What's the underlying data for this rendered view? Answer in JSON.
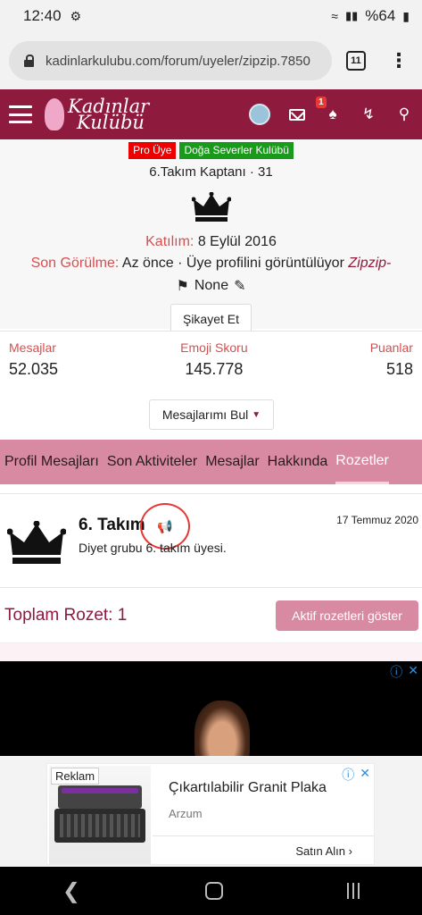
{
  "status_bar": {
    "time": "12:40",
    "battery": "%64"
  },
  "browser": {
    "url": "kadinlarkulubu.com/forum/uyeler/zipzip.7850",
    "tab_count": "11"
  },
  "site": {
    "logo_text_line1": "Kadınlar",
    "logo_text_line2": "Kulübü",
    "notification_badge": "1",
    "brand_color": "#8e1a3d",
    "accent_pink": "#d98aa3"
  },
  "profile": {
    "tags": [
      "Pro Üye",
      "Doğa Severler Kulübü"
    ],
    "subtitle": "6.Takım Kaptanı · 31",
    "joined_label": "Katılım:",
    "joined_value": "8 Eylül 2016",
    "last_seen_label": "Son Görülme:",
    "last_seen_value": "Az önce · Üye profilini görüntülüyor",
    "last_seen_user": "Zipzip-",
    "none_label": "None",
    "report_button": "Şikayet Et"
  },
  "stats": [
    {
      "label": "Mesajlar",
      "value": "52.035"
    },
    {
      "label": "Emoji Skoru",
      "value": "145.778"
    },
    {
      "label": "Puanlar",
      "value": "518"
    }
  ],
  "find_messages_button": "Mesajlarımı Bul",
  "tabs": [
    {
      "label": "Profil Mesajları",
      "active": false
    },
    {
      "label": "Son Aktiviteler",
      "active": false
    },
    {
      "label": "Mesajlar",
      "active": false
    },
    {
      "label": "Hakkında",
      "active": false
    },
    {
      "label": "Rozetler",
      "active": true
    }
  ],
  "trophy": {
    "title": "6. Takım",
    "date": "17 Temmuz 2020",
    "description": "Diyet grubu 6. takım üyesi."
  },
  "total": {
    "label": "Toplam Rozet: 1",
    "button": "Aktif rozetleri göster"
  },
  "ad": {
    "tag": "Reklam",
    "headline": "Çıkartılabilir Granit Plaka",
    "advertiser": "Arzum",
    "cta": "Satın Alın"
  }
}
